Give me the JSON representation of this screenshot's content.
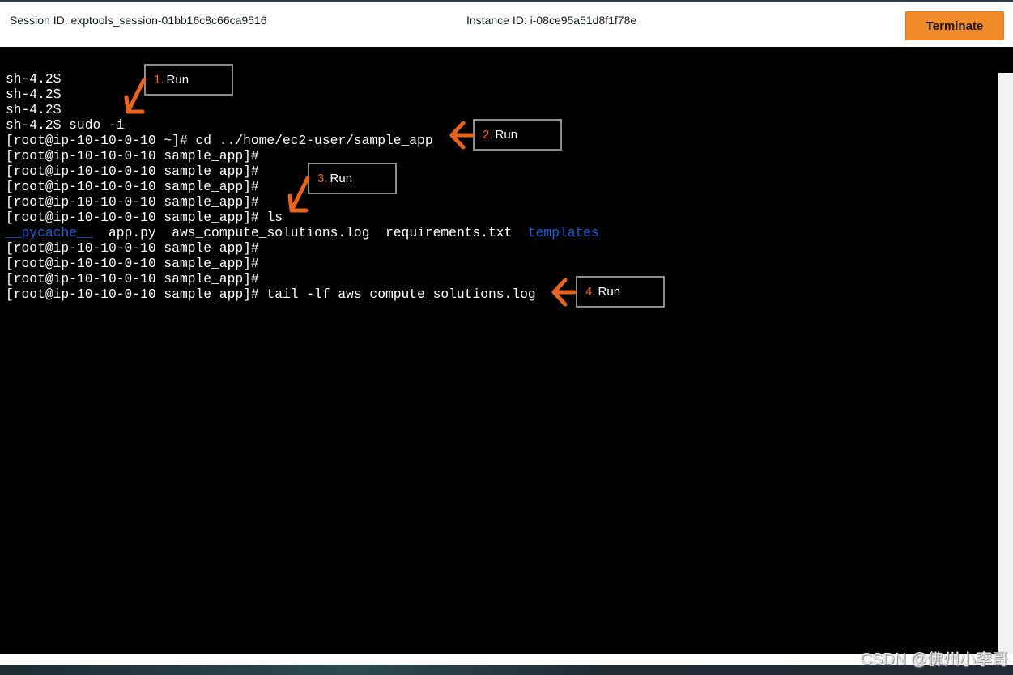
{
  "header": {
    "session_id": "Session ID: exptools_session-01bb16c8c66ca9516",
    "instance_id": "Instance ID: i-08ce95a51d8f1f78e",
    "terminate_label": "Terminate"
  },
  "terminal": {
    "lines": [
      "sh-4.2$",
      "sh-4.2$",
      "sh-4.2$",
      "sh-4.2$ sudo -i",
      "[root@ip-10-10-0-10 ~]# cd ../home/ec2-user/sample_app",
      "[root@ip-10-10-0-10 sample_app]#",
      "[root@ip-10-10-0-10 sample_app]#",
      "[root@ip-10-10-0-10 sample_app]#",
      "[root@ip-10-10-0-10 sample_app]#",
      "[root@ip-10-10-0-10 sample_app]# ls"
    ],
    "ls_output": {
      "dir1": "__pycache__",
      "file1": "app.py",
      "file2": "aws_compute_solutions.log",
      "file3": "requirements.txt",
      "dir2": "templates"
    },
    "lines_after": [
      "[root@ip-10-10-0-10 sample_app]#",
      "[root@ip-10-10-0-10 sample_app]#",
      "[root@ip-10-10-0-10 sample_app]#",
      "[root@ip-10-10-0-10 sample_app]# tail -lf aws_compute_solutions.log"
    ],
    "dir_color": "#1e5fd6"
  },
  "annotations": [
    {
      "num": "1.",
      "label": "Run"
    },
    {
      "num": "2.",
      "label": "Run"
    },
    {
      "num": "3.",
      "label": "Run"
    },
    {
      "num": "4.",
      "label": "Run"
    }
  ],
  "annotation_color": "#e8641e",
  "watermark": "CSDN @佛州小李哥"
}
